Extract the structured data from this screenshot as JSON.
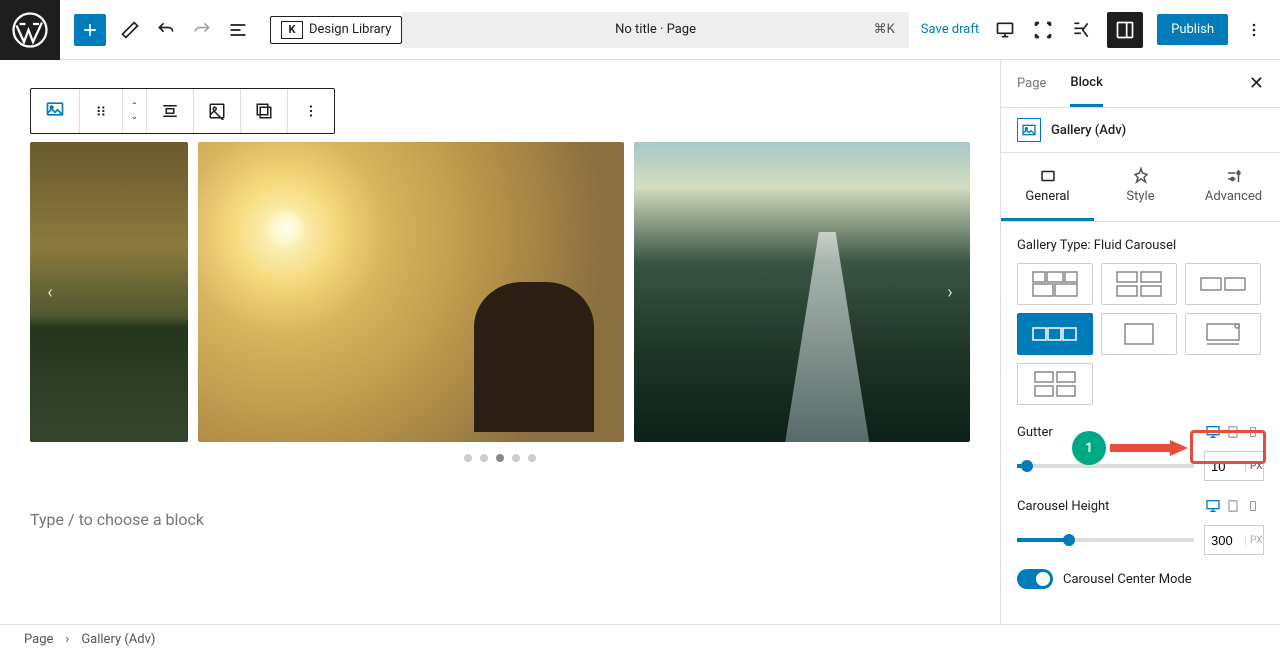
{
  "toolbar": {
    "design_library_label": "Design Library",
    "page_title": "No title · Page",
    "shortcut": "⌘K",
    "save_draft": "Save draft",
    "publish": "Publish"
  },
  "sidebar": {
    "tab_page": "Page",
    "tab_block": "Block",
    "block_name": "Gallery (Adv)",
    "subtabs": {
      "general": "General",
      "style": "Style",
      "advanced": "Advanced"
    },
    "gallery_type_label": "Gallery Type: Fluid Carousel",
    "gutter_label": "Gutter",
    "gutter_value": "10",
    "gutter_unit": "PX",
    "carousel_height_label": "Carousel Height",
    "carousel_height_value": "300",
    "carousel_height_unit": "PX",
    "center_mode_label": "Carousel Center Mode"
  },
  "canvas": {
    "placeholder": "Type / to choose a block"
  },
  "annotation": {
    "number": "1"
  },
  "breadcrumb": {
    "page": "Page",
    "block": "Gallery (Adv)"
  }
}
